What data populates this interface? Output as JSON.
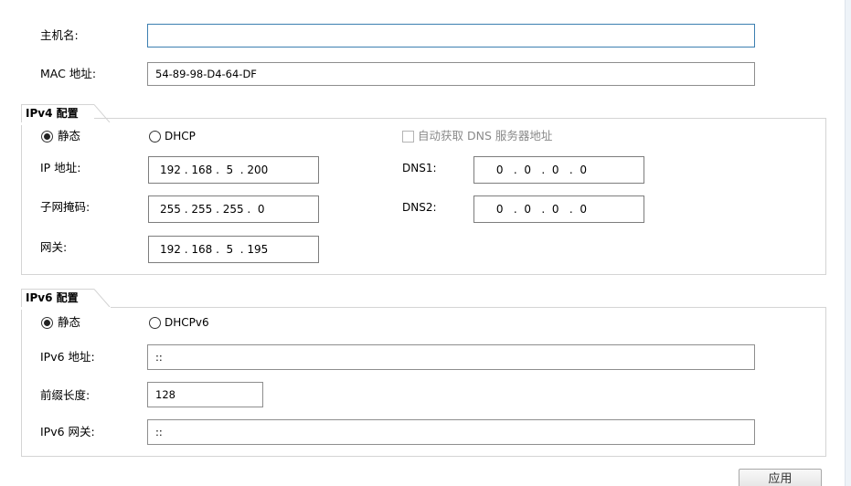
{
  "host": {
    "label": "主机名:",
    "value": ""
  },
  "mac": {
    "label": "MAC 地址:",
    "value": "54-89-98-D4-64-DF"
  },
  "ipv4": {
    "title": "IPv4 配置",
    "static_label": "静态",
    "dhcp_label": "DHCP",
    "auto_dns_label": "自动获取 DNS 服务器地址",
    "ip_label": "IP 地址:",
    "ip_value": "192 . 168 .  5  . 200",
    "mask_label": "子网掩码:",
    "mask_value": "255 . 255 . 255 .  0",
    "gateway_label": "网关:",
    "gateway_value": "192 . 168 .  5  . 195",
    "dns1_label": "DNS1:",
    "dns1_value": " 0   .  0   .  0   .  0",
    "dns2_label": "DNS2:",
    "dns2_value": " 0   .  0   .  0   .  0"
  },
  "ipv6": {
    "title": "IPv6 配置",
    "static_label": "静态",
    "dhcp_label": "DHCPv6",
    "addr_label": "IPv6 地址:",
    "addr_value": "::",
    "prefix_label": "前缀长度:",
    "prefix_value": "128",
    "gateway_label": "IPv6 网关:",
    "gateway_value": "::"
  },
  "apply_label": "应用"
}
